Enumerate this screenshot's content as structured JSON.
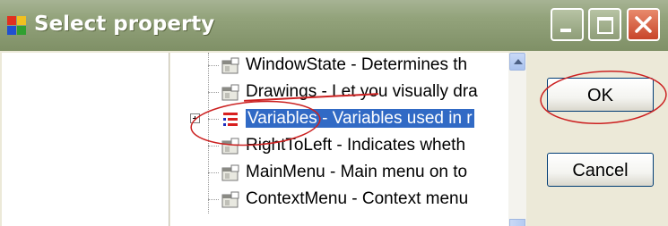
{
  "window": {
    "title": "Select property"
  },
  "tree": {
    "items": [
      {
        "label": "WindowState - Determines th",
        "icon": "property-icon",
        "selected": false
      },
      {
        "label": "Drawings - Let you visually dra",
        "icon": "property-icon",
        "selected": false
      },
      {
        "label": "Variables - Variables used in r",
        "icon": "variables-list-icon",
        "selected": true
      },
      {
        "label": "RightToLeft - Indicates wheth",
        "icon": "property-icon",
        "selected": false
      },
      {
        "label": "MainMenu - Main menu on to",
        "icon": "property-icon",
        "selected": false
      },
      {
        "label": "ContextMenu - Context menu",
        "icon": "property-icon",
        "selected": false
      }
    ]
  },
  "buttons": {
    "ok_label": "OK",
    "cancel_label": "Cancel"
  },
  "colors": {
    "titlebar": "#93a37b",
    "selection": "#316ac5",
    "annotation": "#cc2222"
  }
}
